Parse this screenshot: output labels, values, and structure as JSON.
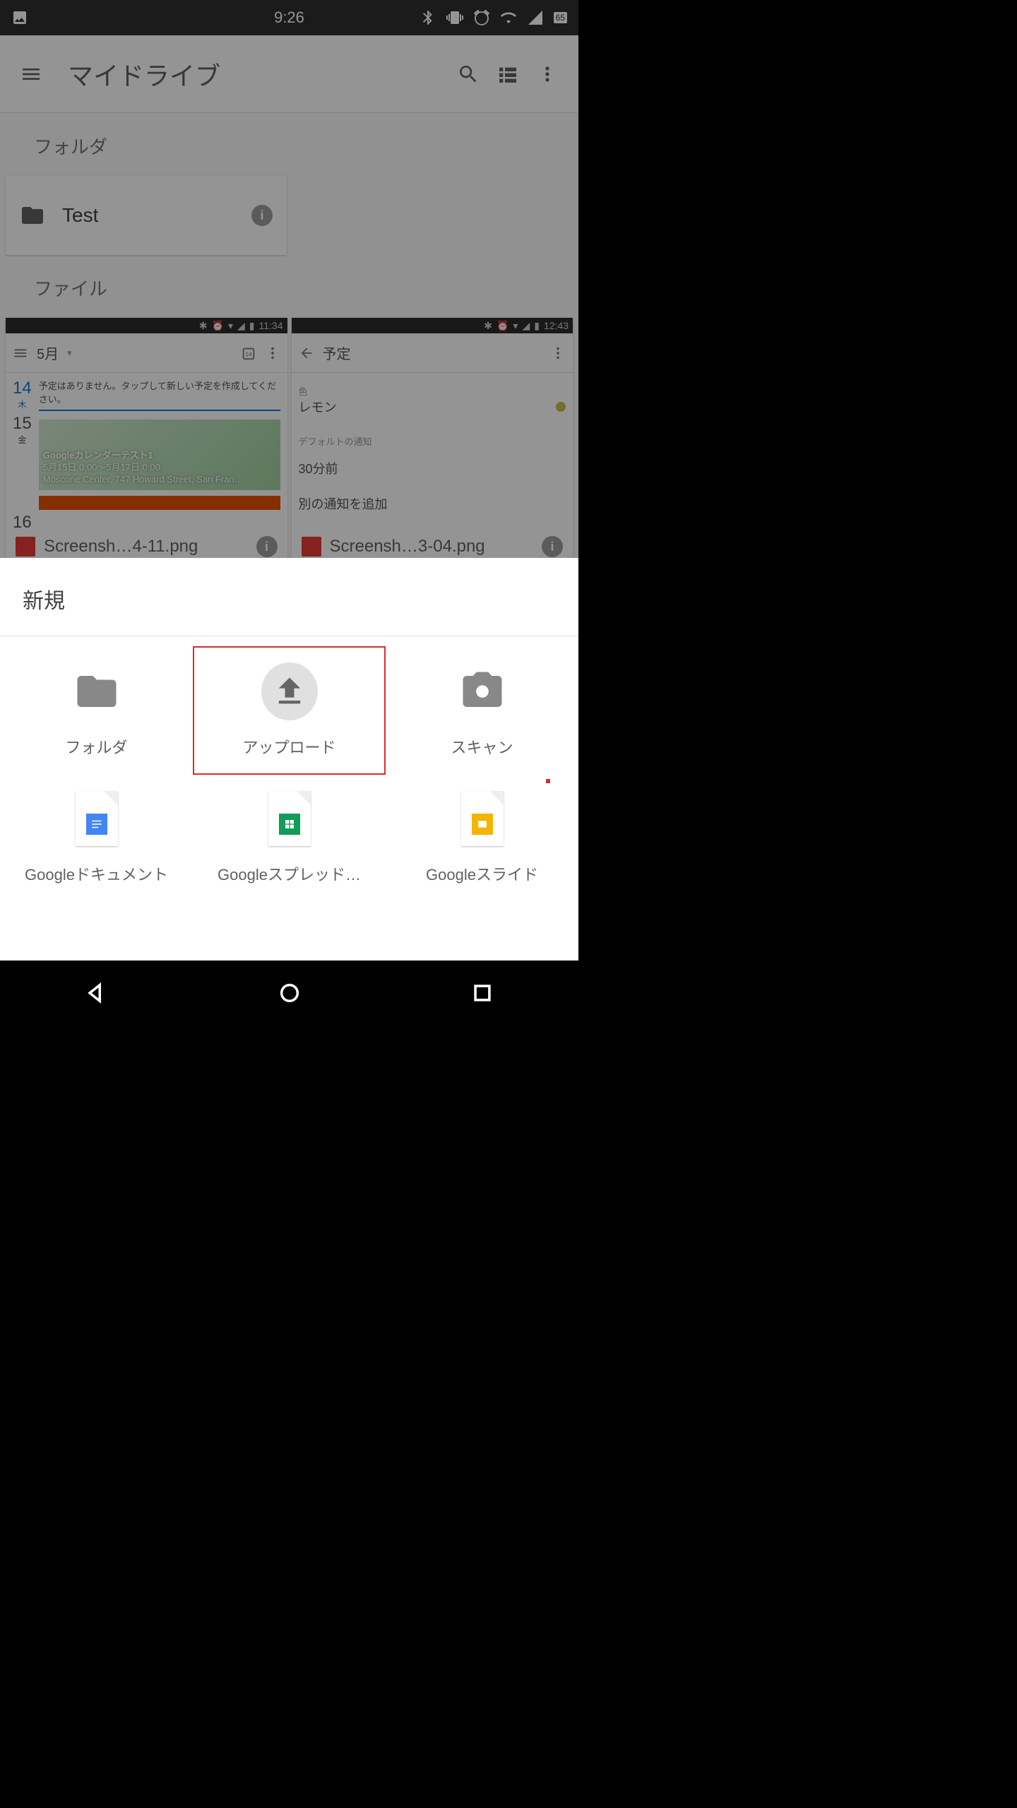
{
  "statusbar": {
    "time": "9:26",
    "battery": "65"
  },
  "appbar": {
    "title": "マイドライブ"
  },
  "sections": {
    "folders_label": "フォルダ",
    "files_label": "ファイル"
  },
  "folder": {
    "name": "Test"
  },
  "files": [
    {
      "name": "Screensh…4-11.png",
      "thumb_time": "11:34",
      "thumb_appbar": "5月",
      "thumb_day_a": "14",
      "thumb_day_a_wd": "木",
      "thumb_empty": "予定はありません。タップして新しい予定を作成してください。",
      "thumb_day_b": "15",
      "thumb_day_b_wd": "金",
      "thumb_ev_title": "Googleカレンダーテスト1",
      "thumb_ev_time": "5月15日 0:00～5月17日 0:00",
      "thumb_ev_loc": "Moscone Center, 747 Howard Street, San Fran…",
      "thumb_day_c": "16"
    },
    {
      "name": "Screensh…3-04.png",
      "thumb_time": "12:43",
      "thumb_appbar": "予定",
      "r1": "色",
      "r1v": "レモン",
      "r2": "デフォルトの通知",
      "r2v": "30分前",
      "r3": "別の通知を追加"
    }
  ],
  "sheet": {
    "title": "新規",
    "items": [
      {
        "label": "フォルダ"
      },
      {
        "label": "アップロード"
      },
      {
        "label": "スキャン"
      },
      {
        "label": "Googleドキュメント"
      },
      {
        "label": "Googleスプレッド…"
      },
      {
        "label": "Googleスライド"
      }
    ]
  }
}
